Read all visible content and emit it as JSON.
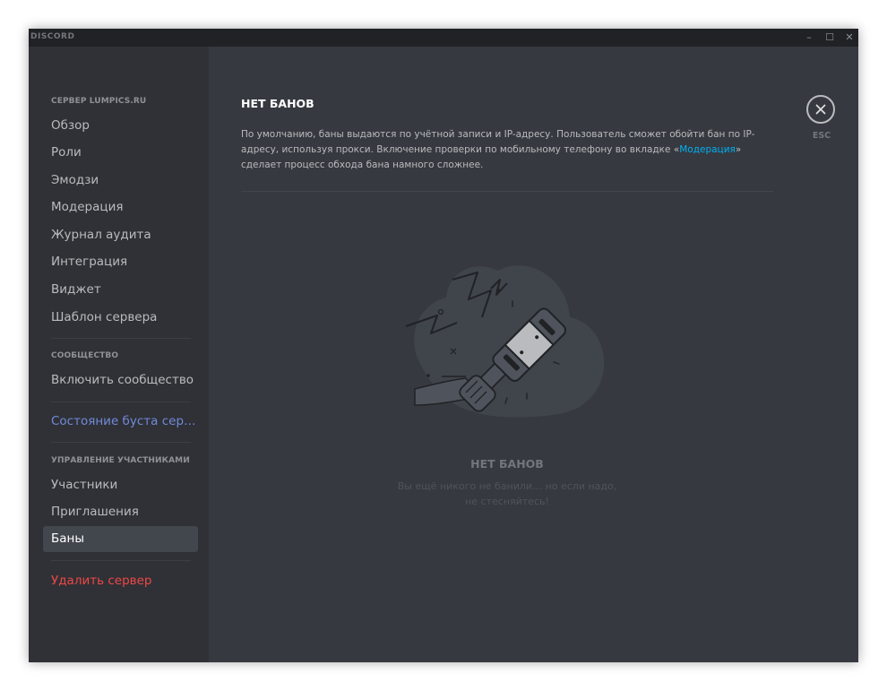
{
  "app": {
    "brand": "DISCORD"
  },
  "window_controls": {
    "minimize": "–",
    "maximize": "☐",
    "close": "✕"
  },
  "sidebar": {
    "server_header": "СЕРВЕР LUMPICS.RU",
    "server_items": [
      "Обзор",
      "Роли",
      "Эмодзи",
      "Модерация",
      "Журнал аудита",
      "Интеграция",
      "Виджет",
      "Шаблон сервера"
    ],
    "community_header": "СООБЩЕСТВО",
    "community_items": [
      "Включить сообщество"
    ],
    "boost_item": "Состояние буста серв...",
    "members_header": "УПРАВЛЕНИЕ УЧАСТНИКАМИ",
    "members_items": [
      "Участники",
      "Приглашения",
      "Баны"
    ],
    "selected_item": "Баны",
    "delete_item": "Удалить сервер"
  },
  "main": {
    "title": "НЕТ БАНОВ",
    "description_before": "По умолчанию, баны выдаются по учётной записи и IP-адресу. Пользователь сможет обойти бан по IP-адресу, используя прокси. Включение проверки по мобильному телефону во вкладке «",
    "description_link": "Модерация",
    "description_after": "» сделает процесс обхода бана намного сложнее.",
    "esc_label": "ESC",
    "empty_title": "НЕТ БАНОВ",
    "empty_text_line1": "Вы ещё никого не банили… но если надо,",
    "empty_text_line2": "не стесняйтесь!"
  },
  "colors": {
    "window_bg": "#36393f",
    "sidebar_bg": "#2f3136",
    "titlebar_bg": "#202225",
    "selected_bg": "#42464d",
    "link": "#00b0f4",
    "boost": "#7289da",
    "danger": "#f04747"
  },
  "icons": {
    "close": "close-icon",
    "illustration": "ban-hammer-illustration"
  }
}
